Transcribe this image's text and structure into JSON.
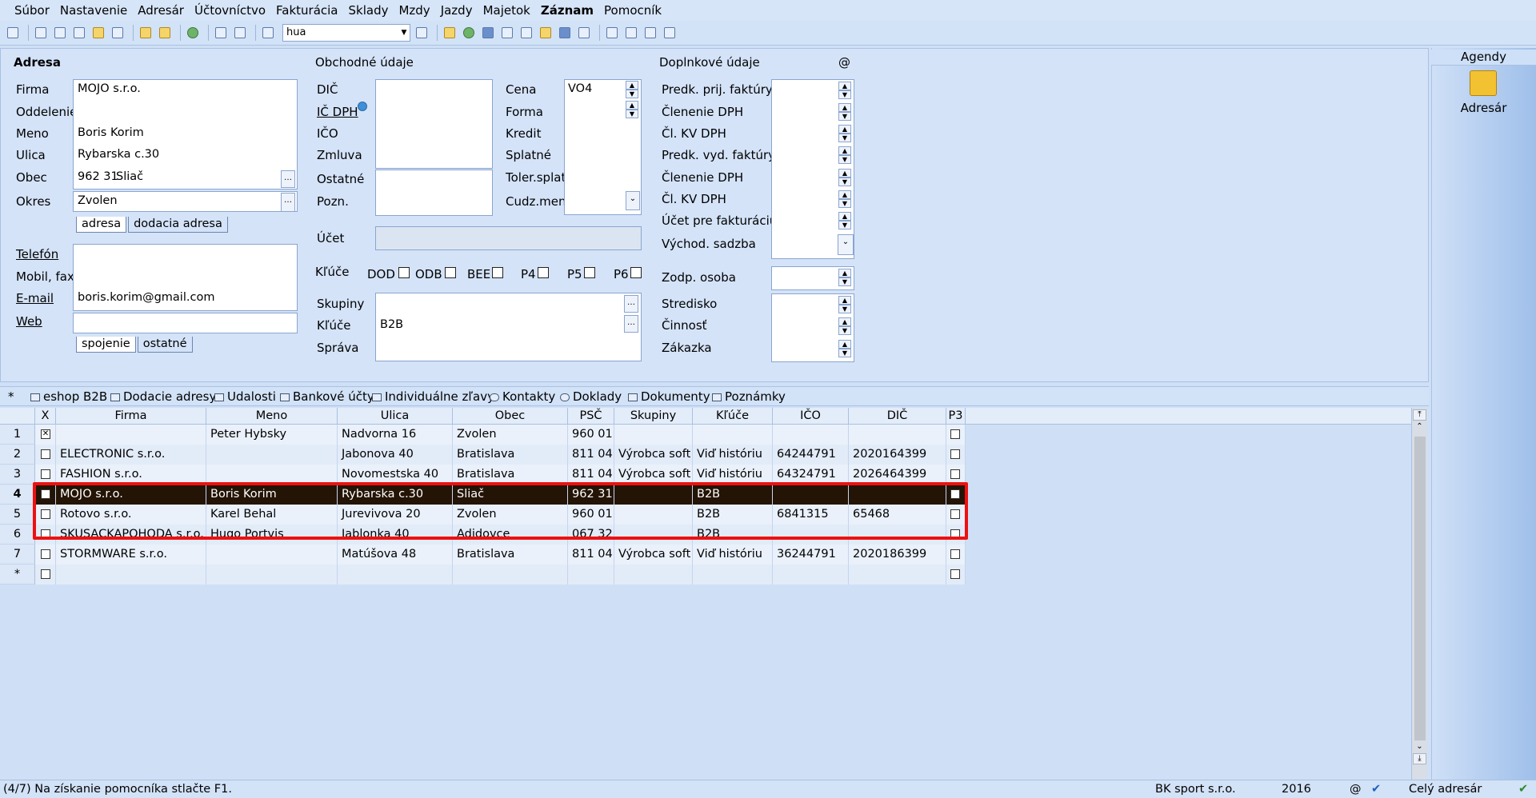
{
  "menu": [
    "Súbor",
    "Nastavenie",
    "Adresár",
    "Účtovníctvo",
    "Fakturácia",
    "Sklady",
    "Mzdy",
    "Jazdy",
    "Majetok",
    "Záznam",
    "Pomocník"
  ],
  "toolbar": {
    "search_value": "hua"
  },
  "form": {
    "adresa": {
      "heading": "Adresa",
      "labels": {
        "firma": "Firma",
        "oddelenie": "Oddelenie",
        "meno": "Meno",
        "ulica": "Ulica",
        "obec": "Obec",
        "okres": "Okres"
      },
      "firma": "MOJO s.r.o.",
      "meno": "Boris Korim",
      "ulica": "Rybarska c.30",
      "psc": "962 31",
      "obec": "Sliač",
      "okres": "Zvolen",
      "tabs": [
        "adresa",
        "dodacia adresa"
      ]
    },
    "kontakt": {
      "labels": {
        "telefon": "Telefón",
        "mobil": "Mobil, fax",
        "email": "E-mail",
        "web": "Web"
      },
      "email": "boris.korim@gmail.com",
      "tabs": [
        "spojenie",
        "ostatné"
      ]
    },
    "obchodne": {
      "heading": "Obchodné údaje",
      "labels": {
        "dic": "DIČ",
        "icdph": "IČ DPH",
        "ico": "IČO",
        "zmluva": "Zmluva",
        "ostatne": "Ostatné",
        "pozn": "Pozn.",
        "cena": "Cena",
        "forma": "Forma",
        "kredit": "Kredit",
        "splatne": "Splatné",
        "toler": "Toler.splat.",
        "cudz": "Cudz.mena",
        "ucet": "Účet",
        "kluce": "Kľúče",
        "skupiny": "Skupiny",
        "kluce2": "Kľúče",
        "sprava": "Správa"
      },
      "cena": "VO4",
      "kluce_items": [
        "DOD",
        "ODB",
        "BEE",
        "P4",
        "P5",
        "P6"
      ],
      "kluce_value": "B2B"
    },
    "doplnkove": {
      "heading": "Doplnkové údaje",
      "at": "@",
      "labels": [
        "Predk. prij. faktúry",
        "Členenie DPH",
        "Čl. KV DPH",
        "Predk. vyd. faktúry",
        "Členenie DPH",
        "Čl. KV DPH",
        "Účet pre fakturáciu",
        "Východ. sadzba"
      ],
      "labels2": [
        "Zodp. osoba"
      ],
      "labels3": [
        "Stredisko",
        "Činnosť",
        "Zákazka"
      ]
    }
  },
  "agendy": {
    "title": "Agendy",
    "item": "Adresár"
  },
  "subtabs": [
    "*",
    "eshop B2B",
    "Dodacie adresy",
    "Udalosti",
    "Bankové účty",
    "Individuálne zľavy",
    "Kontakty",
    "Doklady",
    "Dokumenty",
    "Poznámky"
  ],
  "grid": {
    "columns": [
      "X",
      "Firma",
      "Meno",
      "Ulica",
      "Obec",
      "PSČ",
      "Skupiny",
      "Kľúče",
      "IČO",
      "DIČ",
      "P3"
    ],
    "rows": [
      {
        "num": "1",
        "x": true,
        "firma": "",
        "meno": "Peter Hybsky",
        "ulica": "Nadvorna 16",
        "obec": "Zvolen",
        "psc": "960 01",
        "skupiny": "",
        "kluce": "",
        "ico": "",
        "dic": ""
      },
      {
        "num": "2",
        "x": false,
        "firma": "ELECTRONIC s.r.o.",
        "meno": "",
        "ulica": "Jabonova 40",
        "obec": "Bratislava",
        "psc": "811 04",
        "skupiny": "Výrobca soft",
        "kluce": "Viď históriu",
        "ico": "64244791",
        "dic": "2020164399"
      },
      {
        "num": "3",
        "x": false,
        "firma": "FASHION s.r.o.",
        "meno": "",
        "ulica": "Novomestska 40",
        "obec": "Bratislava",
        "psc": "811 04",
        "skupiny": "Výrobca soft",
        "kluce": "Viď históriu",
        "ico": "64324791",
        "dic": "2026464399"
      },
      {
        "num": "4",
        "x": false,
        "firma": "MOJO s.r.o.",
        "meno": "Boris Korim",
        "ulica": "Rybarska c.30",
        "obec": "Sliač",
        "psc": "962 31",
        "skupiny": "",
        "kluce": "B2B",
        "ico": "",
        "dic": ""
      },
      {
        "num": "5",
        "x": false,
        "firma": "Rotovo s.r.o.",
        "meno": "Karel Behal",
        "ulica": "Jurevivova 20",
        "obec": "Zvolen",
        "psc": "960 01",
        "skupiny": "",
        "kluce": "B2B",
        "ico": "6841315",
        "dic": "65468"
      },
      {
        "num": "6",
        "x": false,
        "firma": "SKUSACKAPOHODA s.r.o.",
        "meno": "Hugo Portvis",
        "ulica": "Jablonka 40",
        "obec": "Adidovce",
        "psc": "067 32",
        "skupiny": "",
        "kluce": "B2B",
        "ico": "",
        "dic": ""
      },
      {
        "num": "7",
        "x": false,
        "firma": "STORMWARE s.r.o.",
        "meno": "",
        "ulica": "Matúšova 48",
        "obec": "Bratislava",
        "psc": "811 04",
        "skupiny": "Výrobca soft",
        "kluce": "Viď históriu",
        "ico": "36244791",
        "dic": "2020186399"
      },
      {
        "num": "*",
        "x": false,
        "firma": "",
        "meno": "",
        "ulica": "",
        "obec": "",
        "psc": "",
        "skupiny": "",
        "kluce": "",
        "ico": "",
        "dic": ""
      }
    ],
    "selected_row": "4"
  },
  "status": {
    "hint": "(4/7) Na získanie pomocníka stlačte F1.",
    "company": "BK sport  s.r.o.",
    "year": "2016",
    "at": "@",
    "scope": "Celý adresár"
  },
  "colors": {
    "highlight": "#ee1111",
    "selected_bg": "#241405"
  }
}
